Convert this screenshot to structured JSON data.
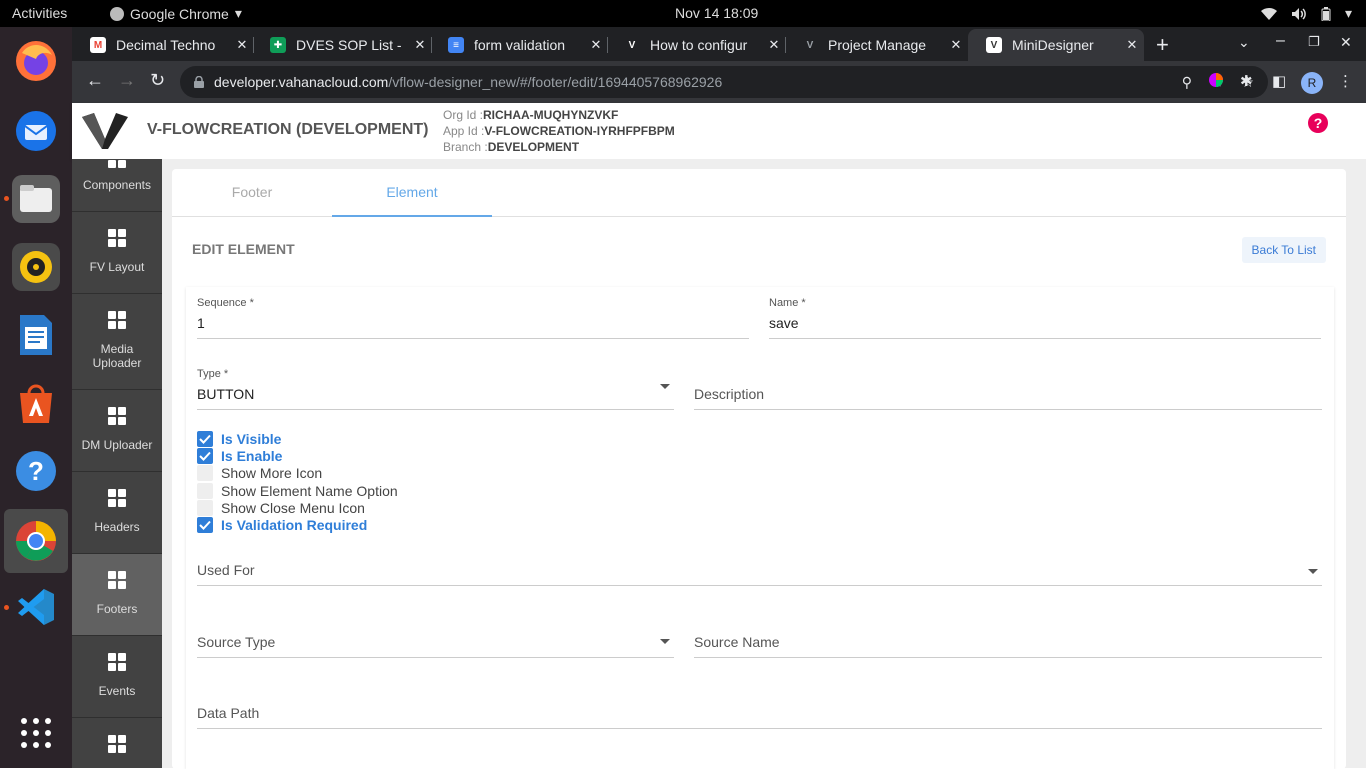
{
  "system": {
    "activities": "Activities",
    "app_name": "Google Chrome",
    "clock": "Nov 14  18:09"
  },
  "browser": {
    "tabs": [
      {
        "label": "Decimal Techno",
        "icon": "gmail-icon",
        "color": "#ea4335"
      },
      {
        "label": "DVES SOP List -",
        "icon": "sheets-icon",
        "color": "#0f9d58"
      },
      {
        "label": "form validation",
        "icon": "docs-icon",
        "color": "#4285f4"
      },
      {
        "label": "How to configur",
        "icon": "vahana-icon",
        "color": "#ffffff"
      },
      {
        "label": "Project Manage",
        "icon": "vahana-icon",
        "color": "#9aa0a6"
      },
      {
        "label": "MiniDesigner",
        "icon": "vahana-icon",
        "color": "#ffffff"
      }
    ],
    "url_host": "developer.vahanacloud.com",
    "url_path": "/vflow-designer_new/#/footer/edit/1694405768962926",
    "profile_initial": "R"
  },
  "header": {
    "title": "V-FLOWCREATION (DEVELOPMENT)",
    "org_label": "Org Id :",
    "org_value": "RICHAA-MUQHYNZVKF",
    "app_label": "App Id :",
    "app_value": "V-FLOWCREATION-IYRHFPFBPM",
    "branch_label": "Branch :",
    "branch_value": "DEVELOPMENT",
    "help": "?"
  },
  "sidebar": {
    "items": [
      {
        "label": "Components"
      },
      {
        "label": "FV Layout"
      },
      {
        "label": "Media Uploader"
      },
      {
        "label": "DM Uploader"
      },
      {
        "label": "Headers"
      },
      {
        "label": "Footers"
      },
      {
        "label": "Events"
      }
    ]
  },
  "main": {
    "tabs": [
      {
        "label": "Footer"
      },
      {
        "label": "Element"
      }
    ],
    "edit_title": "EDIT ELEMENT",
    "back_label": "Back To List",
    "form": {
      "sequence_label": "Sequence *",
      "sequence_value": "1",
      "name_label": "Name *",
      "name_value": "save",
      "type_label": "Type *",
      "type_value": "BUTTON",
      "description_placeholder": "Description",
      "checkboxes": [
        {
          "label": "Is Visible",
          "checked": true
        },
        {
          "label": "Is Enable",
          "checked": true
        },
        {
          "label": "Show More Icon",
          "checked": false
        },
        {
          "label": "Show Element Name Option",
          "checked": false
        },
        {
          "label": "Show Close Menu Icon",
          "checked": false
        },
        {
          "label": "Is Validation Required",
          "checked": true
        }
      ],
      "used_for_placeholder": "Used For",
      "source_type_placeholder": "Source Type",
      "source_name_placeholder": "Source Name",
      "data_path_placeholder": "Data Path"
    }
  },
  "colors": {
    "accent": "#2f7ed8",
    "help": "#e8005a",
    "sidebar": "#424242"
  }
}
